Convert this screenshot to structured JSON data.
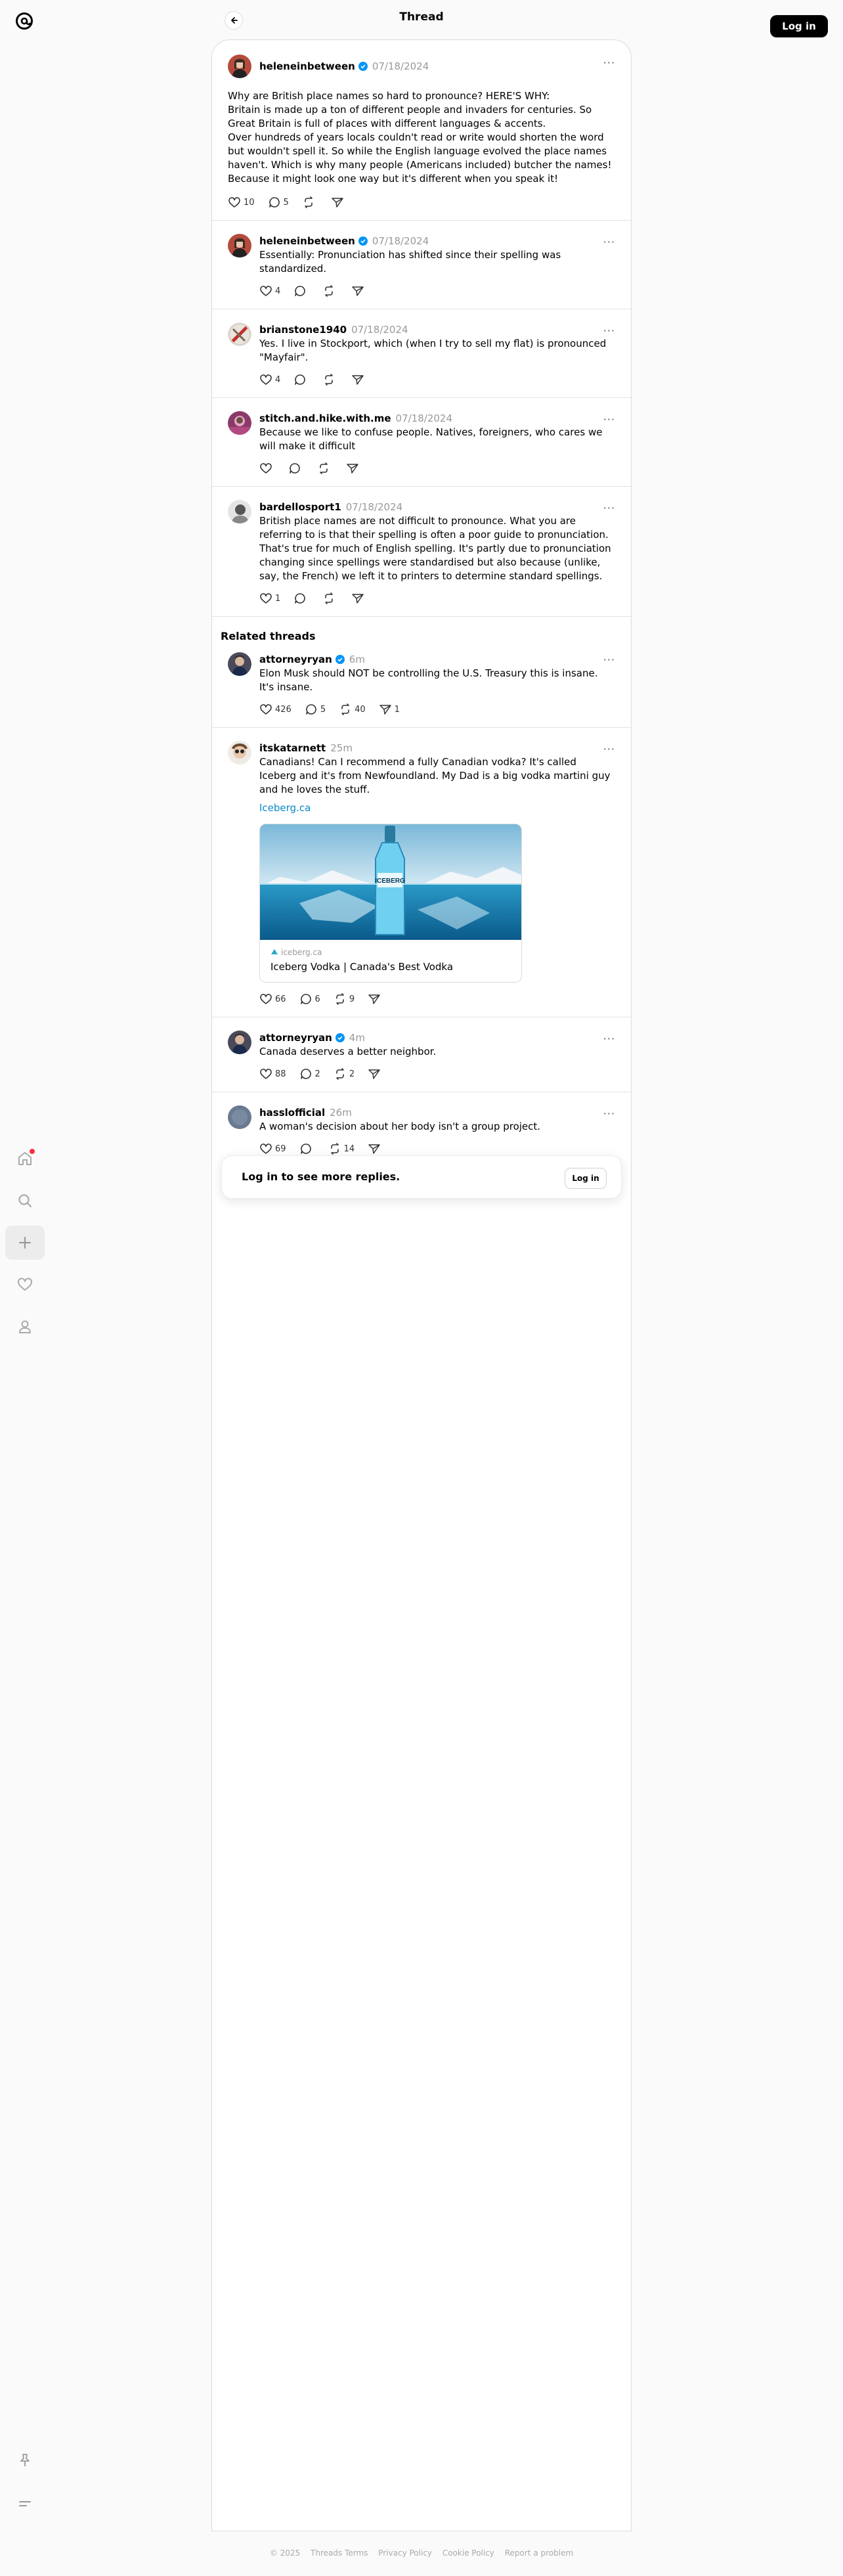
{
  "header": {
    "title": "Thread",
    "login_label": "Log in"
  },
  "rail": {
    "icons": [
      "threads-logo-icon",
      "home-icon",
      "search-icon",
      "create-icon",
      "heart-icon",
      "profile-icon",
      "pin-icon",
      "menu-icon"
    ],
    "notification_color": "#ff3040"
  },
  "main_post": {
    "username": "heleneinbetween",
    "verified": true,
    "date": "07/18/2024",
    "text": "Why are British place names so hard to pronounce? HERE'S WHY:\nBritain is made up a ton of different people and invaders for centuries. So Great Britain is full of places with different languages & accents.\nOver hundreds of years locals couldn't read or write would shorten the word but wouldn't spell it. So while the English language evolved the place names haven't. Which is why many people (Americans included) butcher the names! Because it might look one way but it's different when you speak it!",
    "likes": "10",
    "replies": "5",
    "reposts": "",
    "shares": ""
  },
  "replies": [
    {
      "username": "heleneinbetween",
      "verified": true,
      "date": "07/18/2024",
      "text": "Essentially: Pronunciation has shifted since their spelling was standardized.",
      "likes": "4",
      "replies": "",
      "reposts": "",
      "shares": ""
    },
    {
      "username": "brianstone1940",
      "verified": false,
      "date": "07/18/2024",
      "text": "Yes. I live in Stockport, which (when I try to sell my flat) is pronounced \"Mayfair\".",
      "likes": "4",
      "replies": "",
      "reposts": "",
      "shares": ""
    },
    {
      "username": "stitch.and.hike.with.me",
      "verified": false,
      "date": "07/18/2024",
      "text": "Because we like to confuse people. Natives, foreigners, who cares we will make it difficult",
      "likes": "",
      "replies": "",
      "reposts": "",
      "shares": ""
    },
    {
      "username": "bardellosport1",
      "verified": false,
      "date": "07/18/2024",
      "text": "British place names are not difficult to pronounce. What you are referring to is that their spelling is often a poor guide to pronunciation. That's true for much of English spelling. It's partly due to pronunciation changing since spellings were standardised but also because (unlike, say, the French) we left it to printers to determine standard spellings.",
      "likes": "1",
      "replies": "",
      "reposts": "",
      "shares": ""
    }
  ],
  "related": {
    "heading": "Related threads",
    "posts": [
      {
        "username": "attorneyryan",
        "verified": true,
        "date": "6m",
        "text": "Elon Musk should NOT be controlling the U.S. Treasury this is insane. It's insane.",
        "likes": "426",
        "replies": "5",
        "reposts": "40",
        "shares": "1"
      },
      {
        "username": "itskatarnett",
        "verified": false,
        "date": "25m",
        "text": "Canadians! Can I recommend a fully Canadian vodka? It's called Iceberg and it's from Newfoundland. My Dad is a big vodka martini guy and he loves the stuff.",
        "link_text": "Iceberg.ca",
        "card_domain": "iceberg.ca",
        "card_title": "Iceberg Vodka | Canada's Best Vodka",
        "card_bottle_text": "ICEBERG",
        "likes": "66",
        "replies": "6",
        "reposts": "9",
        "shares": ""
      },
      {
        "username": "attorneyryan",
        "verified": true,
        "date": "4m",
        "text": "Canada deserves a better neighbor.",
        "likes": "88",
        "replies": "2",
        "reposts": "2",
        "shares": ""
      },
      {
        "username": "hasslofficial",
        "verified": false,
        "date": "26m",
        "text": "A woman's decision about her body isn't a group project.",
        "likes": "69",
        "replies": "",
        "reposts": "14",
        "shares": ""
      }
    ]
  },
  "login_prompt": {
    "text": "Log in to see more replies.",
    "button": "Log in"
  },
  "footer": {
    "copyright": "© 2025",
    "links": [
      "Threads Terms",
      "Privacy Policy",
      "Cookie Policy",
      "Report a problem"
    ]
  },
  "colors": {
    "link": "#0a88c9",
    "verified": "#0095f6",
    "muted": "#999999"
  }
}
